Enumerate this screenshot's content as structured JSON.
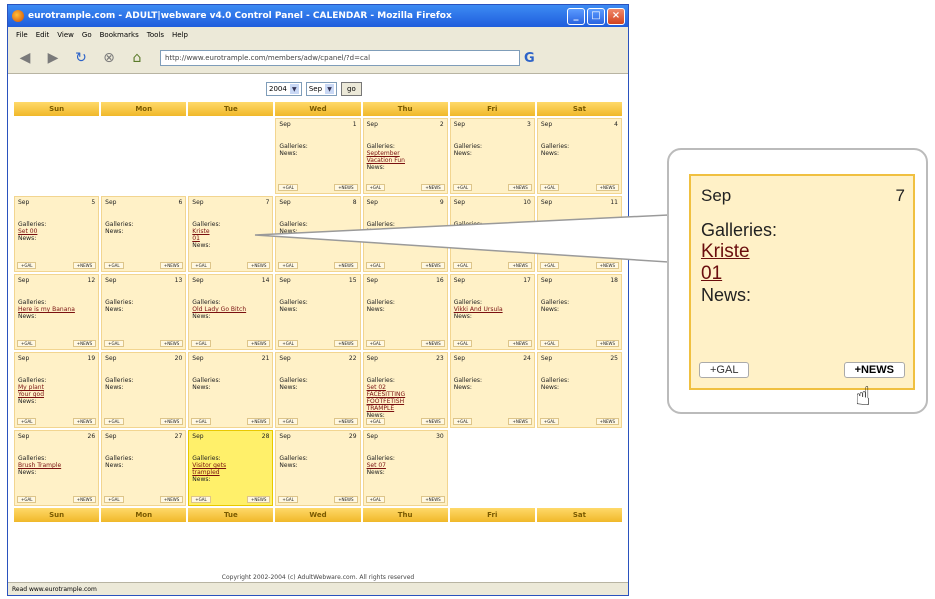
{
  "window": {
    "title": "eurotrample.com - ADULT|webware v4.0 Control Panel - CALENDAR - Mozilla Firefox",
    "buttons": [
      "_",
      "□",
      "×"
    ]
  },
  "menu": [
    "File",
    "Edit",
    "View",
    "Go",
    "Bookmarks",
    "Tools",
    "Help"
  ],
  "url": "http://www.eurotrample.com/members/adw/cpanel/?d=cal",
  "selector": {
    "year": "2004",
    "month": "Sep",
    "go": "go"
  },
  "days": [
    "Sun",
    "Mon",
    "Tue",
    "Wed",
    "Thu",
    "Fri",
    "Sat"
  ],
  "cell": {
    "month": "Sep",
    "galleries": "Galleries:",
    "news": "News:",
    "add_gal": "+GAL",
    "add_news": "+NEWS"
  },
  "weeks": [
    [
      null,
      null,
      null,
      {
        "day": "1",
        "links": []
      },
      {
        "day": "2",
        "links": [
          "September",
          "Vacation Fun"
        ]
      },
      {
        "day": "3",
        "links": []
      },
      {
        "day": "4",
        "links": []
      }
    ],
    [
      {
        "day": "5",
        "links": [
          "Set 00"
        ]
      },
      {
        "day": "6",
        "links": []
      },
      {
        "day": "7",
        "links": [
          "Kriste",
          "01"
        ]
      },
      {
        "day": "8",
        "links": []
      },
      {
        "day": "9",
        "links": []
      },
      {
        "day": "10",
        "links": [
          "Shoeman in",
          "Going For Gas"
        ]
      },
      {
        "day": "11",
        "links": []
      }
    ],
    [
      {
        "day": "12",
        "links": [
          "Here is my Banana"
        ]
      },
      {
        "day": "13",
        "links": []
      },
      {
        "day": "14",
        "links": [
          "Old Lady Go Bitch"
        ]
      },
      {
        "day": "15",
        "links": []
      },
      {
        "day": "16",
        "links": []
      },
      {
        "day": "17",
        "links": [
          "Vikki And Ursula"
        ]
      },
      {
        "day": "18",
        "links": []
      }
    ],
    [
      {
        "day": "19",
        "links": [
          "My plant",
          "Your god"
        ]
      },
      {
        "day": "20",
        "links": []
      },
      {
        "day": "21",
        "links": []
      },
      {
        "day": "22",
        "links": []
      },
      {
        "day": "23",
        "links": [
          "Set 02",
          "FACESITTING",
          "FOOTFETISH",
          "TRAMPLE"
        ]
      },
      {
        "day": "24",
        "links": []
      },
      {
        "day": "25",
        "links": []
      }
    ],
    [
      {
        "day": "26",
        "links": [
          "Brush Trample"
        ]
      },
      {
        "day": "27",
        "links": []
      },
      {
        "day": "28",
        "links": [
          "Visitor gets",
          "trampled"
        ],
        "today": true
      },
      {
        "day": "29",
        "links": []
      },
      {
        "day": "30",
        "links": [
          "Set 07"
        ]
      },
      null,
      null
    ]
  ],
  "copyright": "Copyright 2002-2004 (c) AdultWebware.com. All rights reserved",
  "status": "Read www.eurotrample.com",
  "zoom": {
    "month": "Sep",
    "day": "7",
    "galleries_label": "Galleries:",
    "link1": "Kriste",
    "link2": "01",
    "news_label": "News:",
    "add_gal": "+GAL",
    "add_news": "+NEWS"
  },
  "colors": {
    "accent": "#f0b82a",
    "cell": "#fff1c7",
    "today": "#fff06a",
    "link": "#7a1010"
  }
}
